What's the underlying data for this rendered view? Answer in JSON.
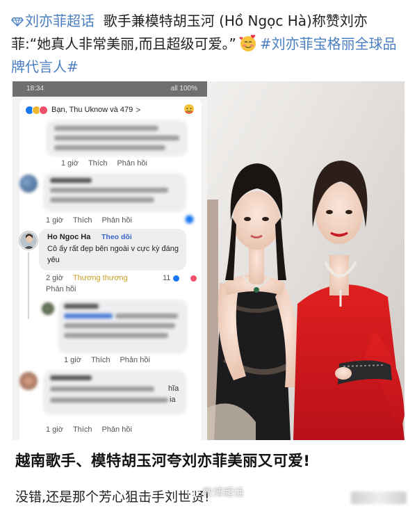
{
  "post": {
    "topic_prefix": "刘亦菲超话",
    "headline": "歌手兼模特胡玉河 (Hồ Ngọc Hà)称赞刘亦菲:“她真人非常美丽,而且超级可爱。”",
    "hashtag": "#刘亦菲宝格丽全球品牌代言人#",
    "topic_color": "#4a7ec2"
  },
  "phone": {
    "status_time": "18:34",
    "status_right": "all 100%",
    "reactions_label": "Bạn, Thu Uknow và 479",
    "chevron": ">",
    "comment_actions": {
      "time": "1 giờ",
      "like": "Thích",
      "reply": "Phản hồi"
    },
    "highlight_comment": {
      "name": "Ho Ngoc Ha",
      "follow": "Theo dõi",
      "text": "Cô ấy rất đẹp bên ngoài v cực kỳ đáng yêu",
      "time": "2 giờ",
      "reaction_word": "Thương thương",
      "reaction_count": "11",
      "reply": "Phản hồi"
    },
    "partial_text_snippet": "hĩa",
    "partial_text_snippet2": "ia"
  },
  "captions": {
    "line1": "越南歌手、模特胡玉河夸刘亦菲美丽又可爱!",
    "line2": "没错,还是那个芳心狙击手刘世贤!"
  },
  "watermark": {
    "text": "微博超话"
  }
}
